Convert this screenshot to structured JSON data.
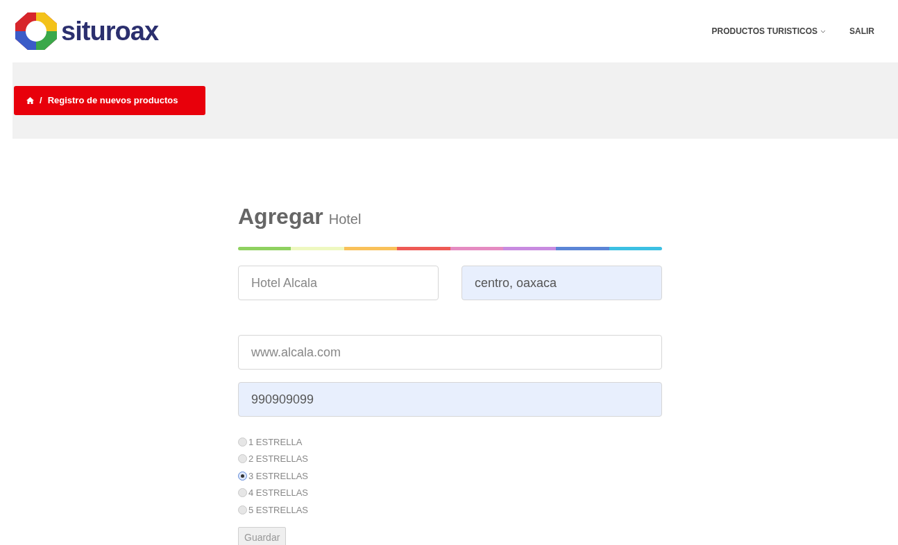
{
  "header": {
    "logo_text": "situroax",
    "nav": [
      {
        "label": "PRODUCTOS TURISTICOS",
        "dropdown": true
      },
      {
        "label": "SALIR",
        "dropdown": false
      }
    ]
  },
  "breadcrumb": {
    "separator": "/",
    "current": "Registro de nuevos productos"
  },
  "form": {
    "title": "Agregar",
    "subtitle": "Hotel",
    "field_rows": [
      [
        {
          "value": "Hotel Alcala",
          "autofilled": false
        },
        {
          "value": "centro, oaxaca",
          "autofilled": true
        }
      ],
      [
        {
          "value": "www.alcala.com",
          "autofilled": false
        }
      ],
      [
        {
          "value": "990909099",
          "autofilled": true
        }
      ]
    ],
    "ratings": [
      {
        "label": "1 ESTRELLA",
        "selected": false
      },
      {
        "label": "2 ESTRELLAS",
        "selected": false
      },
      {
        "label": "3 ESTRELLAS",
        "selected": true
      },
      {
        "label": "4 ESTRELLAS",
        "selected": false
      },
      {
        "label": "5 ESTRELLAS",
        "selected": false
      }
    ],
    "submit": "Guardar"
  }
}
